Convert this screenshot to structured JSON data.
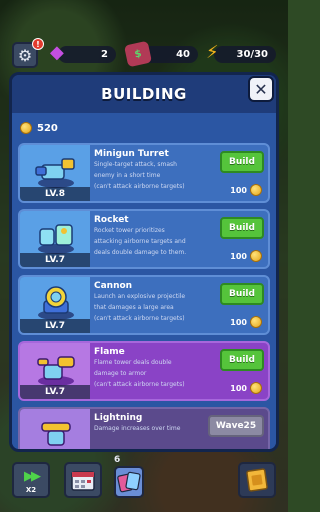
{
  "hud": {
    "notification_badge": "!",
    "gems": "2",
    "cash": "40",
    "energy": "30/30"
  },
  "panel": {
    "title": "BUILDING",
    "close_icon": "✕",
    "coins": "520"
  },
  "towers": [
    {
      "name": "Minigun Turret",
      "level": "LV.8",
      "description": [
        "Single-target attack, smash",
        "enemy in a short time",
        "(can't attack airborne targets)"
      ],
      "button": "Build",
      "cost": "100",
      "style": "blue"
    },
    {
      "name": "Rocket",
      "level": "LV.7",
      "description": [
        "Rocket tower prioritizes",
        "attacking airborne targets and",
        "deals double damage to them."
      ],
      "button": "Build",
      "cost": "100",
      "style": "blue"
    },
    {
      "name": "Cannon",
      "level": "LV.7",
      "description": [
        "Launch an explosive projectile",
        "that damages a large area",
        "(can't attack airborne targets)"
      ],
      "button": "Build",
      "cost": "100",
      "style": "blue"
    },
    {
      "name": "Flame",
      "level": "LV.7",
      "description": [
        "Flame tower deals double",
        "damage to armor",
        "(can't attack airborne targets)"
      ],
      "button": "Build",
      "cost": "100",
      "style": "purple"
    },
    {
      "name": "Lightning",
      "level": "",
      "description": [
        "Damage increases over time"
      ],
      "button": "Wave25",
      "cost": "",
      "style": "locked"
    }
  ],
  "bottom": {
    "speed_label": "X2",
    "cards_count": "6"
  },
  "colors": {
    "build_green": "#55c43b",
    "panel_blue": "#2b56a3",
    "card_purple": "#8a43c6"
  }
}
